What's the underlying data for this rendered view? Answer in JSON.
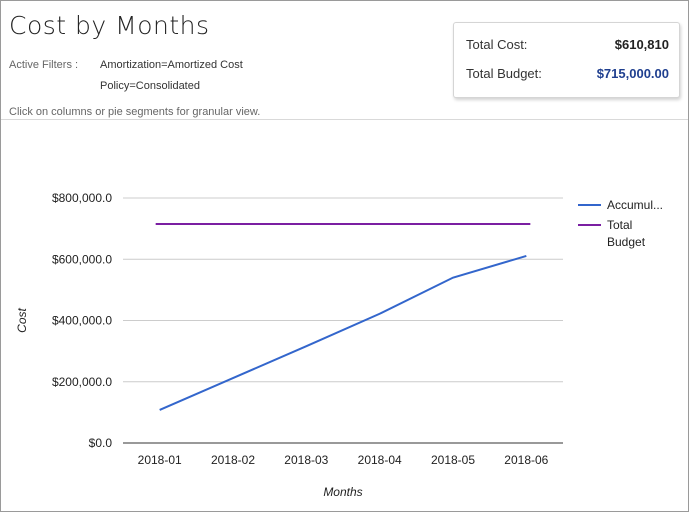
{
  "header": {
    "title": "Cost by Months",
    "filters_label": "Active Filters :",
    "filters": [
      "Amortization=Amortized Cost",
      "Policy=Consolidated"
    ],
    "hint": "Click on columns or pie segments for granular view."
  },
  "summary": {
    "cost_label": "Total Cost:",
    "cost_value": "$610,810",
    "budget_label": "Total Budget:",
    "budget_value": "$715,000.00",
    "cost_color": "#222222",
    "budget_color": "#1f3f8f"
  },
  "chart_data": {
    "type": "line",
    "categories": [
      "2018-01",
      "2018-02",
      "2018-03",
      "2018-04",
      "2018-05",
      "2018-06"
    ],
    "series": [
      {
        "name": "Accumul...",
        "color": "#3366cc",
        "values": [
          108000,
          212000,
          316000,
          422000,
          540000,
          610810
        ]
      },
      {
        "name": "Total Budget",
        "color": "#7b1fa2",
        "values": [
          715000,
          715000,
          715000,
          715000,
          715000,
          715000
        ]
      }
    ],
    "xlabel": "Months",
    "ylabel": "Cost",
    "ylim": [
      0,
      800000
    ],
    "yticks": [
      0,
      200000,
      400000,
      600000,
      800000
    ],
    "ytick_labels": [
      "$0.0",
      "$200,000.0",
      "$400,000.0",
      "$600,000.0",
      "$800,000.0"
    ],
    "grid": true,
    "legend": "right"
  }
}
